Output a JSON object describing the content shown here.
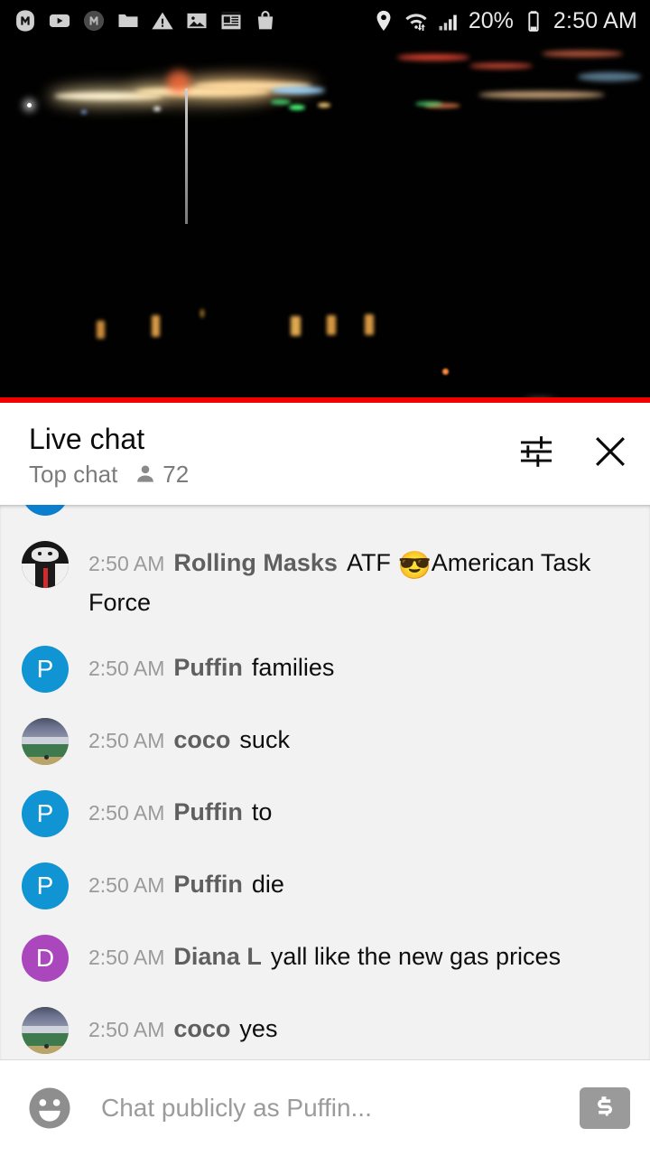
{
  "status_bar": {
    "left_icons": [
      {
        "name": "monoprice-m-icon",
        "glyph": "M"
      },
      {
        "name": "youtube-icon",
        "glyph": "play"
      },
      {
        "name": "m-app-icon",
        "glyph": "M"
      },
      {
        "name": "folder-icon",
        "glyph": "folder"
      },
      {
        "name": "warning-icon",
        "glyph": "warning"
      },
      {
        "name": "photo-icon",
        "glyph": "image"
      },
      {
        "name": "news-icon",
        "glyph": "news"
      },
      {
        "name": "shopping-bag-icon",
        "glyph": "bag"
      }
    ],
    "location_icon": "location-pin-icon",
    "wifi_icon": "wifi-transfer-icon",
    "signal_icon": "cell-signal-icon",
    "battery_percent": "20%",
    "battery_icon": "battery-icon",
    "clock": "2:50 AM"
  },
  "video": {
    "name": "live-video-player",
    "progress_color": "#f00000",
    "progress_percent": 100,
    "background_color": "#000000",
    "description": "night cityscape with distant lights"
  },
  "chat_header": {
    "title": "Live chat",
    "mode": "Top chat",
    "viewer_icon": "person-icon",
    "viewer_count": "72",
    "settings_icon": "chat-settings-sliders-icon",
    "close_icon": "close-icon"
  },
  "messages": [
    {
      "id": "clipped-top",
      "time": "",
      "author": "",
      "text": "",
      "avatar": {
        "type": "letter",
        "letter": "",
        "color": "#0b7fce"
      },
      "clipped": true
    },
    {
      "id": "msg-rolling-masks",
      "time": "2:50 AM",
      "author": "Rolling Masks",
      "text_before_emoji": "ATF ",
      "emoji": "😎",
      "text_after_emoji": "American Task Force",
      "text": "ATF 😎 American Task Force",
      "avatar": {
        "type": "photo-mask",
        "letter": "",
        "color": "#171717"
      }
    },
    {
      "id": "msg-puffin-families",
      "time": "2:50 AM",
      "author": "Puffin",
      "text": "families",
      "avatar": {
        "type": "letter",
        "letter": "P",
        "color": "#1094d4"
      }
    },
    {
      "id": "msg-coco-suck",
      "time": "2:50 AM",
      "author": "coco",
      "text": "suck",
      "avatar": {
        "type": "photo-stadium",
        "letter": "",
        "color": "#5d7d56"
      }
    },
    {
      "id": "msg-puffin-to",
      "time": "2:50 AM",
      "author": "Puffin",
      "text": "to",
      "avatar": {
        "type": "letter",
        "letter": "P",
        "color": "#1094d4"
      }
    },
    {
      "id": "msg-puffin-die",
      "time": "2:50 AM",
      "author": "Puffin",
      "text": "die",
      "avatar": {
        "type": "letter",
        "letter": "P",
        "color": "#1094d4"
      }
    },
    {
      "id": "msg-diana-gas",
      "time": "2:50 AM",
      "author": "Diana L",
      "text": "yall like the new gas prices",
      "avatar": {
        "type": "letter",
        "letter": "D",
        "color": "#ab47bc"
      }
    },
    {
      "id": "msg-coco-yes",
      "time": "2:50 AM",
      "author": "coco",
      "text": "yes",
      "avatar": {
        "type": "photo-stadium",
        "letter": "",
        "color": "#5d7d56"
      }
    }
  ],
  "chat_input": {
    "emoji_icon": "emoji-smiley-icon",
    "placeholder": "Chat publicly as Puffin...",
    "value": "",
    "superchat_icon": "super-chat-dollar-icon"
  },
  "colors": {
    "accent_red": "#f00000",
    "chat_bg": "#f2f2f2",
    "header_bg": "#ffffff",
    "avatar_blue": "#1094d4",
    "avatar_purple": "#ab47bc"
  }
}
